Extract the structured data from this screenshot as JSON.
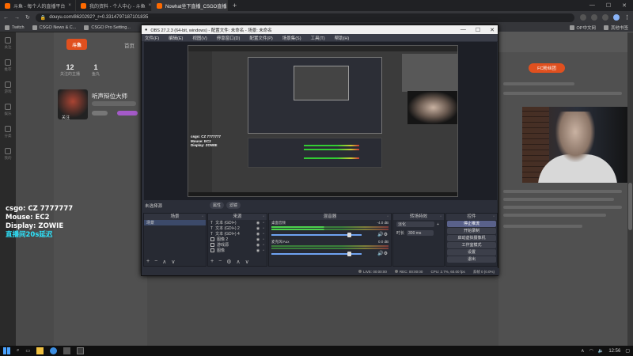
{
  "browser": {
    "tabs": [
      {
        "title": "斗鱼 - 每个人的直播平台",
        "active": false
      },
      {
        "title": "我的资料 - 个人中心 - 斗鱼",
        "active": false
      },
      {
        "title": "Nowhat坐下直播_CSGO直播...",
        "active": true
      }
    ],
    "new_tab": "+",
    "url": "douyu.com/8620292?_r=0.3314797187101835",
    "bookmarks": [
      "Twitch",
      "CSGO News & C...",
      "CSGO Pro Setting...",
      "OP中文网",
      "其他书签"
    ]
  },
  "page": {
    "logo": "斗鱼",
    "home_label": "首页",
    "stats": [
      {
        "value": "12",
        "label": "关注的主播"
      },
      {
        "value": "1",
        "label": "鱼丸"
      }
    ],
    "streamer_name": "听声辩位大师",
    "follow_label": "关注",
    "fc_button": "FC粉丝团",
    "overlay_lines": [
      "csgo: CZ 7777777",
      "Mouse: EC2",
      "Display: ZOWIE"
    ],
    "overlay_delay": "直播间20s延迟",
    "sidenav": [
      "关注",
      "推荐",
      "游戏",
      "娱乐",
      "分类",
      "我的"
    ]
  },
  "obs": {
    "title": "OBS 27.2.3 (64-bit, windows) - 配置文件: 未命名 - 场景: 未命名",
    "menu": [
      "文件(F)",
      "编辑(E)",
      "视图(V)",
      "停靠窗口(D)",
      "配置文件(P)",
      "场景集(S)",
      "工具(T)",
      "帮助(H)"
    ],
    "preview_overlay": [
      "csgo: CZ 7777777",
      "Mouse: EC2",
      "Display: ZOWIE"
    ],
    "scene_label": "未选择源",
    "preview_buttons": [
      "属性",
      "滤镜"
    ],
    "docks": {
      "scenes": {
        "title": "场景",
        "items": [
          "场景"
        ]
      },
      "sources": {
        "title": "来源",
        "items": [
          "文本 (GDI+)",
          "文本 (GDI+) 2",
          "文本 (GDI+) 4",
          "图像 2",
          "游戏源",
          "图像"
        ]
      },
      "mixer": {
        "title": "混音器",
        "tracks": [
          {
            "name": "桌面音频",
            "db": "-4.0 dB"
          },
          {
            "name": "麦克风/Aux",
            "db": "0.0 dB"
          }
        ]
      },
      "transitions": {
        "title": "转场特效",
        "type": "淡化",
        "duration_label": "时长",
        "duration": "300 ms"
      },
      "controls": {
        "title": "控件",
        "buttons": [
          "停止推流",
          "开始录制",
          "启动虚拟摄像机",
          "工作室模式",
          "设置",
          "退出"
        ],
        "active_button": "停止推流"
      }
    },
    "status": {
      "live": "LIVE: 00:00:00",
      "rec": "REC: 00:00:00",
      "cpu": "CPU: 2.7%, 60.00 fps",
      "dropped": "丢帧 0 (0.0%)"
    }
  },
  "webcam": {
    "description": "streamer webcam"
  },
  "taskbar": {
    "time": "12:56",
    "date": "2022/5/29"
  }
}
